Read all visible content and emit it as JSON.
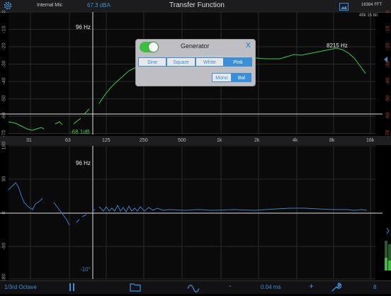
{
  "topbar": {
    "input_label": "Internal Mic",
    "spl_value": "67.3 dBA",
    "title": "Transfer Function",
    "fft_label": "16384 FFT",
    "sample_info": "48k 16 bit"
  },
  "magnitude": {
    "y_ticks": [
      "0",
      "-10",
      "-20",
      "-30",
      "-40",
      "-50",
      "-60",
      "-70"
    ],
    "x_ticks": [
      "31",
      "63",
      "125",
      "250",
      "500",
      "1k",
      "2k",
      "4k",
      "8k",
      "16k"
    ],
    "cursor_freq_label": "96 Hz",
    "cursor_value_label": "-68.1dB",
    "peak_label": "8215 Hz",
    "right_scale": [
      "0",
      "-10",
      "-20",
      "-30",
      "-40",
      "-50",
      "-60",
      "-70"
    ]
  },
  "phase": {
    "y_ticks": [
      "180",
      "90",
      "0",
      "-90",
      "-180"
    ],
    "cursor_freq_label": "96 Hz",
    "cursor_value_label": "-10°"
  },
  "generator": {
    "title": "Generator",
    "close_label": "X",
    "toggle_on": true,
    "signal_options": [
      "Sine",
      "Square",
      "White",
      "Pink"
    ],
    "selected_signal": "Pink",
    "channel_options": [
      "Mono",
      "Bal"
    ],
    "selected_channel": "Bal"
  },
  "bottombar": {
    "averaging_label": "1/3rd Octave",
    "delay_value": "0.04 ms",
    "plus_label": "+",
    "minus_label": "-",
    "count_label": "8"
  },
  "colors": {
    "magnitude_trace": "#2fd04a",
    "phase_trace": "#3a7fd0",
    "accent": "#3a8fd8",
    "right_scale": "#c0392b"
  },
  "icons": [
    "settings-gear-icon",
    "photo-icon",
    "pause-icon",
    "folder-icon",
    "waveform-icon",
    "wrench-icon"
  ]
}
